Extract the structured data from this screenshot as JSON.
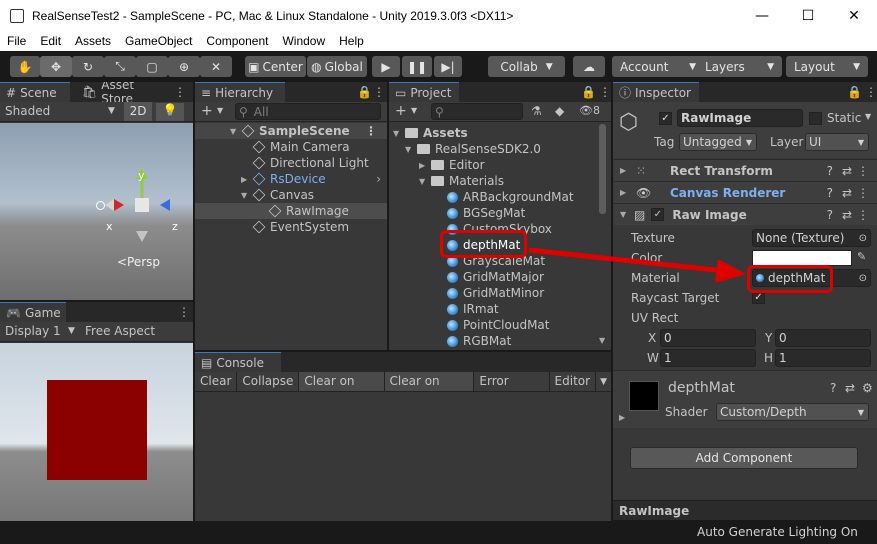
{
  "window": {
    "title": "RealSenseTest2 - SampleScene - PC, Mac & Linux Standalone - Unity 2019.3.0f3 <DX11>"
  },
  "menu": [
    "File",
    "Edit",
    "Assets",
    "GameObject",
    "Component",
    "Window",
    "Help"
  ],
  "toolbar": {
    "center": "Center",
    "global": "Global",
    "collab": "Collab",
    "account": "Account",
    "layers": "Layers",
    "layout": "Layout"
  },
  "scene": {
    "tab": "Scene",
    "tab2": "Asset Store",
    "shading": "Shaded",
    "mode2d": "2D",
    "persp": "<Persp",
    "axis_x": "x",
    "axis_y": "y",
    "axis_z": "z"
  },
  "game": {
    "tab": "Game",
    "display": "Display 1",
    "aspect": "Free Aspect"
  },
  "hierarchy": {
    "tab": "Hierarchy",
    "search": "All",
    "items": [
      "SampleScene",
      "Main Camera",
      "Directional Light",
      "RsDevice",
      "Canvas",
      "RawImage",
      "EventSystem"
    ]
  },
  "project": {
    "tab": "Project",
    "hidden_count": "8",
    "folders": [
      "Assets",
      "RealSenseSDK2.0",
      "Editor",
      "Materials"
    ],
    "materials": [
      "ARBackgroundMat",
      "BGSegMat",
      "CustomSkybox",
      "depthMat",
      "GrayscaleMat",
      "GridMatMajor",
      "GridMatMinor",
      "IRmat",
      "PointCloudMat",
      "RGBMat"
    ]
  },
  "console": {
    "tab": "Console",
    "buttons": [
      "Clear",
      "Collapse",
      "Clear on Play",
      "Clear on Build",
      "Error Pause",
      "Editor"
    ]
  },
  "inspector": {
    "tab": "Inspector",
    "object_name": "RawImage",
    "static": "Static",
    "tag_label": "Tag",
    "tag": "Untagged",
    "layer_label": "Layer",
    "layer": "UI",
    "components": [
      "Rect Transform",
      "Canvas Renderer",
      "Raw Image"
    ],
    "texture_label": "Texture",
    "texture": "None (Texture)",
    "color_label": "Color",
    "material_label": "Material",
    "material": "depthMat",
    "raycast_label": "Raycast Target",
    "uvrect_label": "UV Rect",
    "x_label": "X",
    "x": "0",
    "y_label": "Y",
    "y": "0",
    "w_label": "W",
    "w": "1",
    "h_label": "H",
    "h": "1",
    "mat_name": "depthMat",
    "shader_label": "Shader",
    "shader": "Custom/Depth",
    "add_component": "Add Component",
    "preview": "RawImage"
  },
  "status": {
    "text": "Auto Generate Lighting On"
  },
  "colors": {
    "highlight": "#e00000",
    "accent": "#3a79bb",
    "game_square": "#8b0000"
  }
}
